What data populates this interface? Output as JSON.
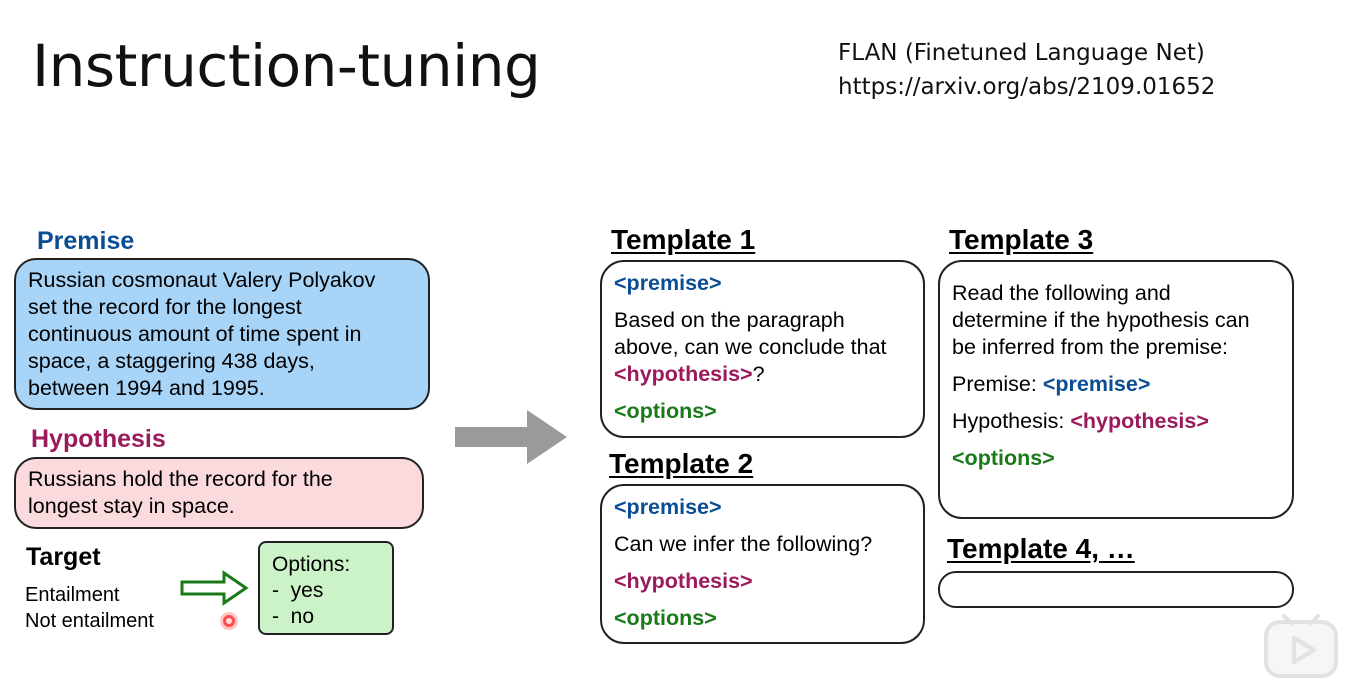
{
  "slide": {
    "title": "Instruction-tuning",
    "reference": {
      "name": "FLAN (Finetuned Language Net)",
      "url": "https://arxiv.org/abs/2109.01652"
    }
  },
  "example": {
    "premise_label": "Premise",
    "premise_lines": [
      "Russian cosmonaut Valery Polyakov",
      "set the record for the longest",
      "continuous amount of time spent in",
      "space, a staggering 438 days,",
      "between 1994 and 1995."
    ],
    "hypothesis_label": "Hypothesis",
    "hypothesis_lines": [
      "Russians hold the record for the",
      "longest stay in space."
    ],
    "target_label": "Target",
    "target_values": [
      "Entailment",
      "Not entailment"
    ],
    "options_title": "Options:",
    "options": [
      "-  yes",
      "-  no"
    ]
  },
  "templates": {
    "t1": {
      "title": "Template 1",
      "premise_tag": "<premise>",
      "text_lines": [
        "Based on the paragraph",
        "above, can we conclude that"
      ],
      "hypothesis_tag": "<hypothesis>",
      "hypothesis_suffix": "?",
      "options_tag": "<options>"
    },
    "t2": {
      "title": "Template 2",
      "premise_tag": "<premise>",
      "text": "Can we infer the following?",
      "hypothesis_tag": "<hypothesis>",
      "options_tag": "<options>"
    },
    "t3": {
      "title": "Template 3",
      "text_lines": [
        "Read the following and",
        "determine if the hypothesis can",
        "be inferred from the premise:"
      ],
      "premise_prefix": "Premise: ",
      "premise_tag": "<premise>",
      "hypothesis_prefix": "Hypothesis: ",
      "hypothesis_tag": "<hypothesis>",
      "options_tag": "<options>"
    },
    "t4": {
      "title": "Template 4, …"
    }
  },
  "colors": {
    "premise": "#0b4d95",
    "hypothesis": "#9b1a5b",
    "options": "#1a7a1a",
    "premise_box": "#a8d4f7",
    "hypothesis_box": "#fadadd",
    "options_box": "#ccf3c8",
    "arrow": "#9a9a9a"
  },
  "icons": [
    "big-right-arrow-icon",
    "hollow-right-arrow-icon",
    "play-button-icon",
    "recording-dot-icon"
  ]
}
